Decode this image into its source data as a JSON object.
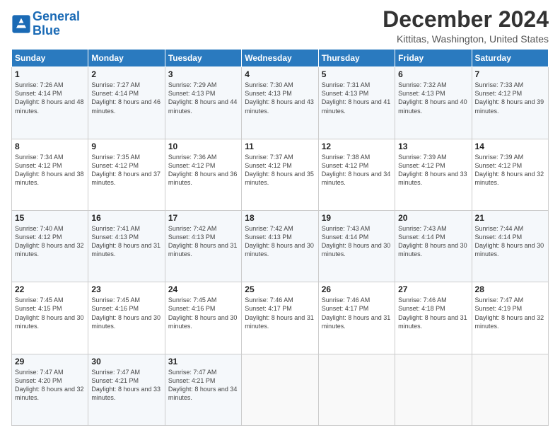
{
  "header": {
    "logo_line1": "General",
    "logo_line2": "Blue",
    "month": "December 2024",
    "location": "Kittitas, Washington, United States"
  },
  "days_of_week": [
    "Sunday",
    "Monday",
    "Tuesday",
    "Wednesday",
    "Thursday",
    "Friday",
    "Saturday"
  ],
  "weeks": [
    [
      {
        "day": "1",
        "rise": "Sunrise: 7:26 AM",
        "set": "Sunset: 4:14 PM",
        "daylight": "Daylight: 8 hours and 48 minutes."
      },
      {
        "day": "2",
        "rise": "Sunrise: 7:27 AM",
        "set": "Sunset: 4:14 PM",
        "daylight": "Daylight: 8 hours and 46 minutes."
      },
      {
        "day": "3",
        "rise": "Sunrise: 7:29 AM",
        "set": "Sunset: 4:13 PM",
        "daylight": "Daylight: 8 hours and 44 minutes."
      },
      {
        "day": "4",
        "rise": "Sunrise: 7:30 AM",
        "set": "Sunset: 4:13 PM",
        "daylight": "Daylight: 8 hours and 43 minutes."
      },
      {
        "day": "5",
        "rise": "Sunrise: 7:31 AM",
        "set": "Sunset: 4:13 PM",
        "daylight": "Daylight: 8 hours and 41 minutes."
      },
      {
        "day": "6",
        "rise": "Sunrise: 7:32 AM",
        "set": "Sunset: 4:13 PM",
        "daylight": "Daylight: 8 hours and 40 minutes."
      },
      {
        "day": "7",
        "rise": "Sunrise: 7:33 AM",
        "set": "Sunset: 4:12 PM",
        "daylight": "Daylight: 8 hours and 39 minutes."
      }
    ],
    [
      {
        "day": "8",
        "rise": "Sunrise: 7:34 AM",
        "set": "Sunset: 4:12 PM",
        "daylight": "Daylight: 8 hours and 38 minutes."
      },
      {
        "day": "9",
        "rise": "Sunrise: 7:35 AM",
        "set": "Sunset: 4:12 PM",
        "daylight": "Daylight: 8 hours and 37 minutes."
      },
      {
        "day": "10",
        "rise": "Sunrise: 7:36 AM",
        "set": "Sunset: 4:12 PM",
        "daylight": "Daylight: 8 hours and 36 minutes."
      },
      {
        "day": "11",
        "rise": "Sunrise: 7:37 AM",
        "set": "Sunset: 4:12 PM",
        "daylight": "Daylight: 8 hours and 35 minutes."
      },
      {
        "day": "12",
        "rise": "Sunrise: 7:38 AM",
        "set": "Sunset: 4:12 PM",
        "daylight": "Daylight: 8 hours and 34 minutes."
      },
      {
        "day": "13",
        "rise": "Sunrise: 7:39 AM",
        "set": "Sunset: 4:12 PM",
        "daylight": "Daylight: 8 hours and 33 minutes."
      },
      {
        "day": "14",
        "rise": "Sunrise: 7:39 AM",
        "set": "Sunset: 4:12 PM",
        "daylight": "Daylight: 8 hours and 32 minutes."
      }
    ],
    [
      {
        "day": "15",
        "rise": "Sunrise: 7:40 AM",
        "set": "Sunset: 4:12 PM",
        "daylight": "Daylight: 8 hours and 32 minutes."
      },
      {
        "day": "16",
        "rise": "Sunrise: 7:41 AM",
        "set": "Sunset: 4:13 PM",
        "daylight": "Daylight: 8 hours and 31 minutes."
      },
      {
        "day": "17",
        "rise": "Sunrise: 7:42 AM",
        "set": "Sunset: 4:13 PM",
        "daylight": "Daylight: 8 hours and 31 minutes."
      },
      {
        "day": "18",
        "rise": "Sunrise: 7:42 AM",
        "set": "Sunset: 4:13 PM",
        "daylight": "Daylight: 8 hours and 30 minutes."
      },
      {
        "day": "19",
        "rise": "Sunrise: 7:43 AM",
        "set": "Sunset: 4:14 PM",
        "daylight": "Daylight: 8 hours and 30 minutes."
      },
      {
        "day": "20",
        "rise": "Sunrise: 7:43 AM",
        "set": "Sunset: 4:14 PM",
        "daylight": "Daylight: 8 hours and 30 minutes."
      },
      {
        "day": "21",
        "rise": "Sunrise: 7:44 AM",
        "set": "Sunset: 4:14 PM",
        "daylight": "Daylight: 8 hours and 30 minutes."
      }
    ],
    [
      {
        "day": "22",
        "rise": "Sunrise: 7:45 AM",
        "set": "Sunset: 4:15 PM",
        "daylight": "Daylight: 8 hours and 30 minutes."
      },
      {
        "day": "23",
        "rise": "Sunrise: 7:45 AM",
        "set": "Sunset: 4:16 PM",
        "daylight": "Daylight: 8 hours and 30 minutes."
      },
      {
        "day": "24",
        "rise": "Sunrise: 7:45 AM",
        "set": "Sunset: 4:16 PM",
        "daylight": "Daylight: 8 hours and 30 minutes."
      },
      {
        "day": "25",
        "rise": "Sunrise: 7:46 AM",
        "set": "Sunset: 4:17 PM",
        "daylight": "Daylight: 8 hours and 31 minutes."
      },
      {
        "day": "26",
        "rise": "Sunrise: 7:46 AM",
        "set": "Sunset: 4:17 PM",
        "daylight": "Daylight: 8 hours and 31 minutes."
      },
      {
        "day": "27",
        "rise": "Sunrise: 7:46 AM",
        "set": "Sunset: 4:18 PM",
        "daylight": "Daylight: 8 hours and 31 minutes."
      },
      {
        "day": "28",
        "rise": "Sunrise: 7:47 AM",
        "set": "Sunset: 4:19 PM",
        "daylight": "Daylight: 8 hours and 32 minutes."
      }
    ],
    [
      {
        "day": "29",
        "rise": "Sunrise: 7:47 AM",
        "set": "Sunset: 4:20 PM",
        "daylight": "Daylight: 8 hours and 32 minutes."
      },
      {
        "day": "30",
        "rise": "Sunrise: 7:47 AM",
        "set": "Sunset: 4:21 PM",
        "daylight": "Daylight: 8 hours and 33 minutes."
      },
      {
        "day": "31",
        "rise": "Sunrise: 7:47 AM",
        "set": "Sunset: 4:21 PM",
        "daylight": "Daylight: 8 hours and 34 minutes."
      },
      null,
      null,
      null,
      null
    ]
  ]
}
